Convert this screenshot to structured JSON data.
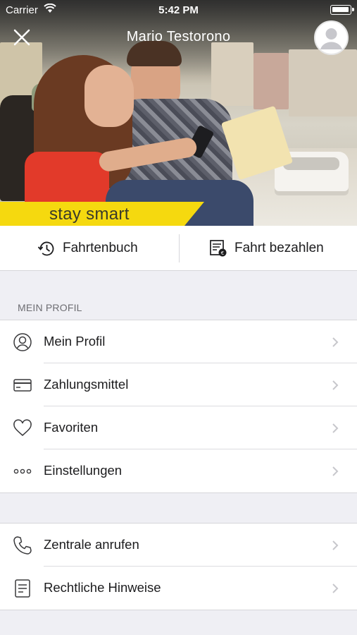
{
  "status_bar": {
    "carrier": "Carrier",
    "time": "5:42 PM"
  },
  "header": {
    "user_name": "Mario  Testorono"
  },
  "hero": {
    "banner_text": "stay smart",
    "banner_color": "#f5d90f"
  },
  "actions": {
    "logbook_label": "Fahrtenbuch",
    "pay_label": "Fahrt bezahlen"
  },
  "profile_section": {
    "header": "MEIN PROFIL",
    "items": [
      {
        "label": "Mein Profil",
        "icon": "user-circle-icon"
      },
      {
        "label": "Zahlungsmittel",
        "icon": "credit-card-icon"
      },
      {
        "label": "Favoriten",
        "icon": "heart-icon"
      },
      {
        "label": "Einstellungen",
        "icon": "more-dots-icon"
      }
    ]
  },
  "support_section": {
    "items": [
      {
        "label": "Zentrale anrufen",
        "icon": "phone-icon"
      },
      {
        "label": "Rechtliche Hinweise",
        "icon": "document-icon"
      }
    ]
  },
  "colors": {
    "background": "#efeff4",
    "accent_yellow": "#f5d90f",
    "text": "#1c1c1e",
    "secondary_text": "#6d6d72"
  }
}
